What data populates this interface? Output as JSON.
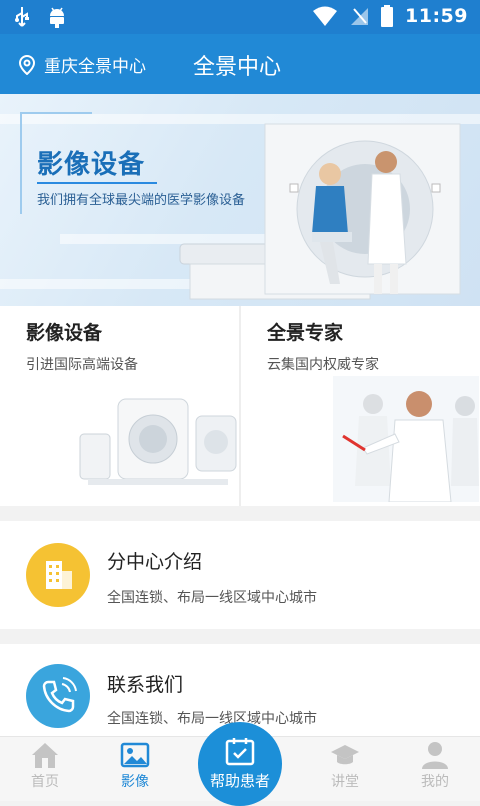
{
  "status": {
    "time": "11:59"
  },
  "header": {
    "location": "重庆全景中心",
    "title": "全景中心"
  },
  "banner": {
    "title": "影像设备",
    "subtitle": "我们拥有全球最尖端的医学影像设备"
  },
  "cards": [
    {
      "title": "影像设备",
      "subtitle": "引进国际高端设备"
    },
    {
      "title": "全景专家",
      "subtitle": "云集国内权威专家"
    }
  ],
  "list": [
    {
      "title": "分中心介绍",
      "subtitle": "全国连锁、布局一线区域中心城市",
      "icon": "building-icon",
      "color": "#f5c233"
    },
    {
      "title": "联系我们",
      "subtitle": "全国连锁、布局一线区域中心城市",
      "icon": "phone-icon",
      "color": "#3aa5dd"
    }
  ],
  "nav": [
    {
      "label": "首页",
      "icon": "home-icon"
    },
    {
      "label": "影像",
      "icon": "image-icon"
    },
    {
      "label": "帮助患者",
      "icon": "calendar-check-icon"
    },
    {
      "label": "讲堂",
      "icon": "graduation-cap-icon"
    },
    {
      "label": "我的",
      "icon": "user-icon"
    }
  ],
  "colors": {
    "primary": "#2189d6",
    "statusbar": "#1f7fcf",
    "inactive": "#bbbbbb"
  }
}
